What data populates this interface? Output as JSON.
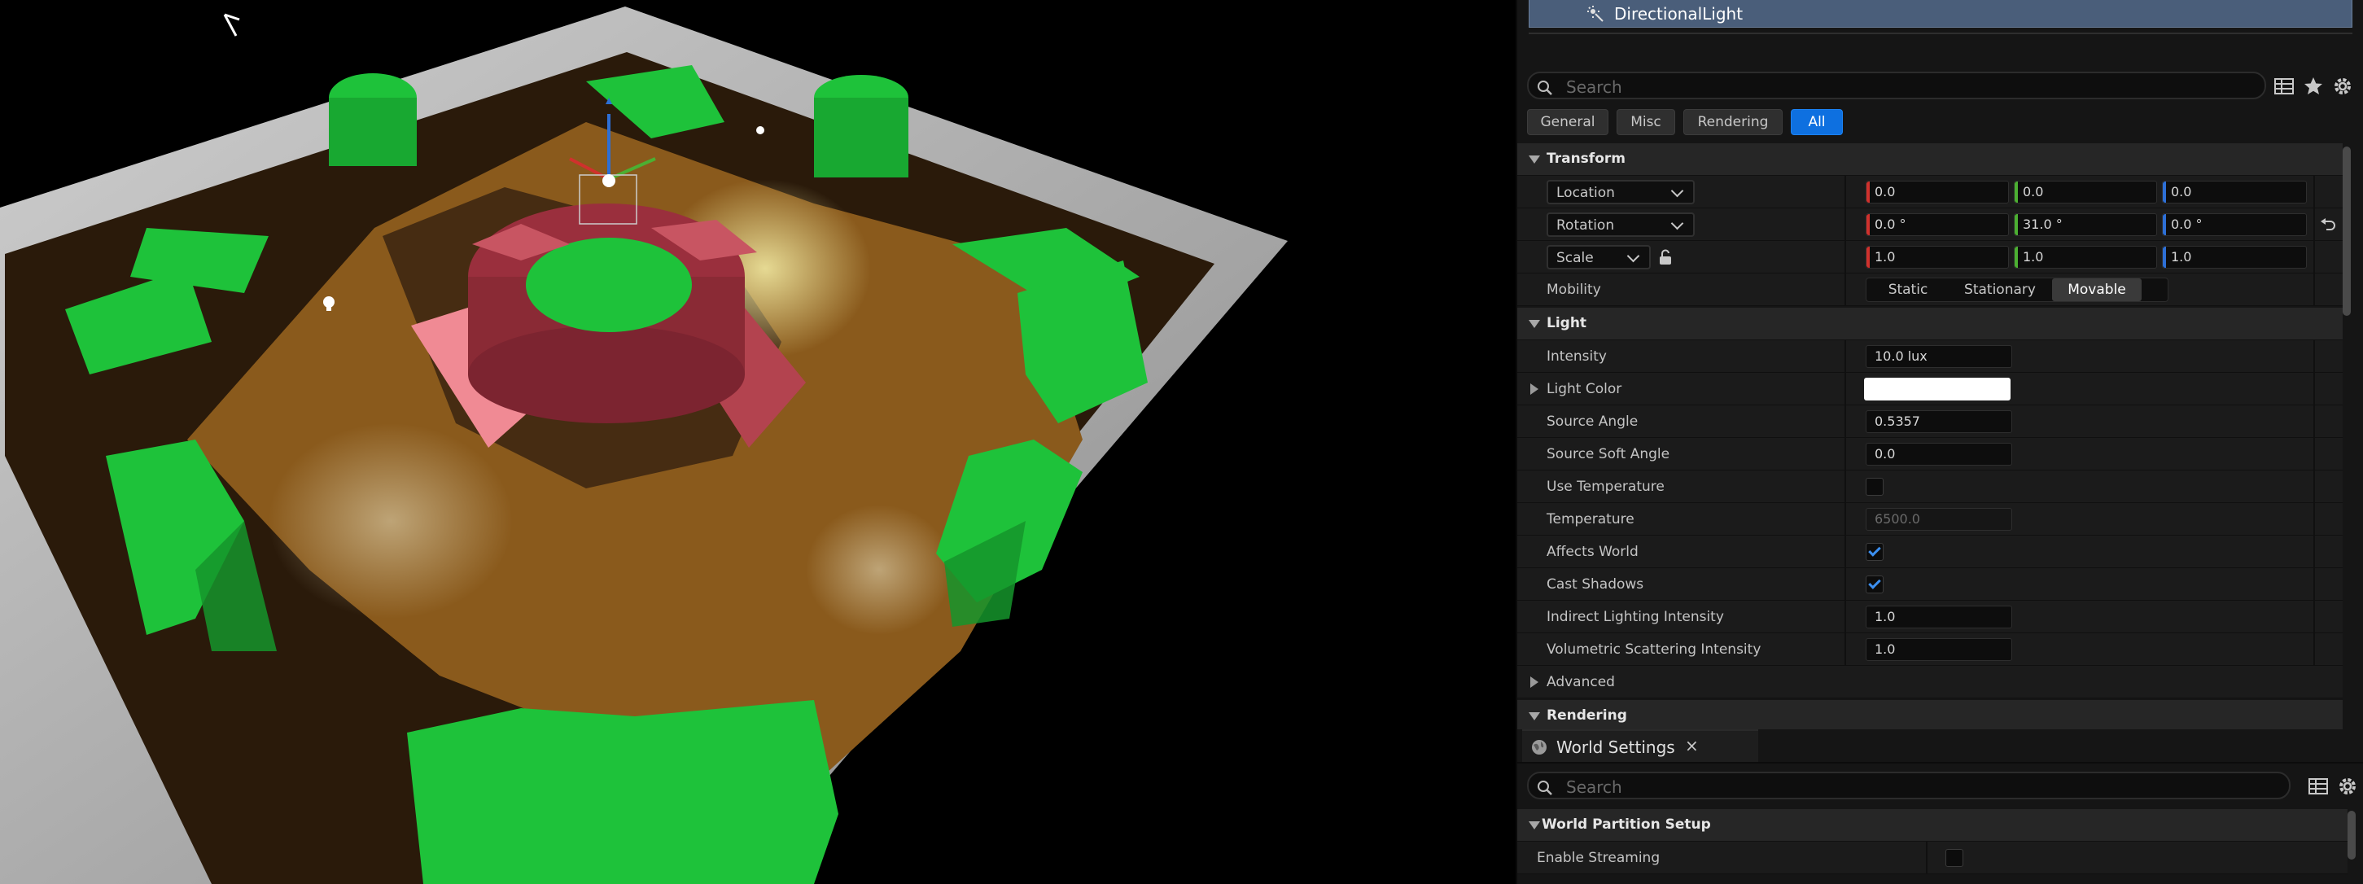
{
  "outliner": {
    "selected_item": "DirectionalLight",
    "item_icon": "directional-light-icon"
  },
  "details": {
    "search_placeholder": "Search",
    "filters": [
      {
        "label": "General",
        "active": false
      },
      {
        "label": "Misc",
        "active": false
      },
      {
        "label": "Rendering",
        "active": false
      },
      {
        "label": "All",
        "active": true
      }
    ],
    "transform": {
      "title": "Transform",
      "location": {
        "mode": "Location",
        "x": "0.0",
        "y": "0.0",
        "z": "0.0"
      },
      "rotation": {
        "mode": "Rotation",
        "x": "0.0 °",
        "y": "31.0 °",
        "z": "0.0 °"
      },
      "scale": {
        "mode": "Scale",
        "x": "1.0",
        "y": "1.0",
        "z": "1.0"
      },
      "mobility_label": "Mobility",
      "mobility_options": [
        "Static",
        "Stationary",
        "Movable"
      ],
      "mobility_selected": "Movable"
    },
    "light": {
      "title": "Light",
      "intensity_label": "Intensity",
      "intensity": "10.0 lux",
      "light_color_label": "Light Color",
      "light_color": "#ffffff",
      "source_angle_label": "Source Angle",
      "source_angle": "0.5357",
      "source_soft_angle_label": "Source Soft Angle",
      "source_soft_angle": "0.0",
      "use_temperature_label": "Use Temperature",
      "use_temperature": false,
      "temperature_label": "Temperature",
      "temperature": "6500.0",
      "affects_world_label": "Affects World",
      "affects_world": true,
      "cast_shadows_label": "Cast Shadows",
      "cast_shadows": true,
      "indirect_label": "Indirect Lighting Intensity",
      "indirect": "1.0",
      "volumetric_label": "Volumetric Scattering Intensity",
      "volumetric": "1.0"
    },
    "advanced_title": "Advanced",
    "rendering_title": "Rendering"
  },
  "world_settings": {
    "tab_label": "World Settings",
    "close_glyph": "×",
    "search_placeholder": "Search",
    "section_title": "World Partition Setup",
    "enable_streaming_label": "Enable Streaming",
    "enable_streaming": false
  },
  "colors": {
    "accent": "#0e70e0",
    "selection_row": "#4a5e7a",
    "axis_x": "#d0312d",
    "axis_y": "#4caf32",
    "axis_z": "#2d6fd6",
    "ground": "#8a5a1c",
    "blocks": "#1ec23a",
    "center": "#b3434f",
    "wall": "#9c9c9c"
  }
}
